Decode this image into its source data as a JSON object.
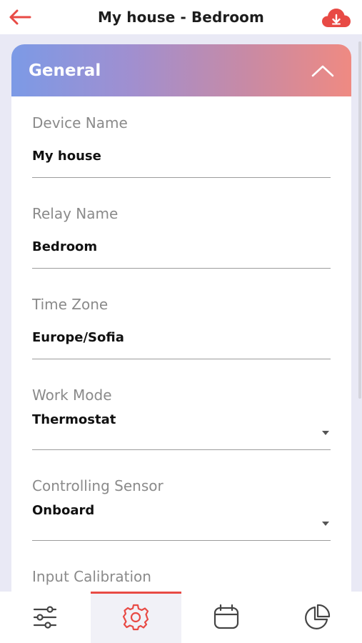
{
  "header": {
    "title": "My house - Bedroom",
    "back_icon": "back-arrow-icon",
    "cloud_icon": "cloud-download-icon",
    "accent": "#e84a45"
  },
  "section": {
    "title": "General",
    "collapse_icon": "chevron-up-icon"
  },
  "fields": {
    "device_name": {
      "label": "Device Name",
      "value": "My house"
    },
    "relay_name": {
      "label": "Relay Name",
      "value": "Bedroom"
    },
    "time_zone": {
      "label": "Time Zone",
      "value": "Europe/Sofia"
    },
    "work_mode": {
      "label": "Work Mode",
      "value": "Thermostat"
    },
    "controlling_sensor": {
      "label": "Controlling Sensor",
      "value": "Onboard"
    },
    "input_calibration": {
      "label": "Input Calibration"
    }
  },
  "nav": {
    "items": [
      {
        "name": "settings-sliders",
        "icon": "sliders-icon"
      },
      {
        "name": "configuration",
        "icon": "gear-icon",
        "active": true
      },
      {
        "name": "schedule",
        "icon": "calendar-icon"
      },
      {
        "name": "statistics",
        "icon": "pie-chart-icon"
      }
    ]
  }
}
